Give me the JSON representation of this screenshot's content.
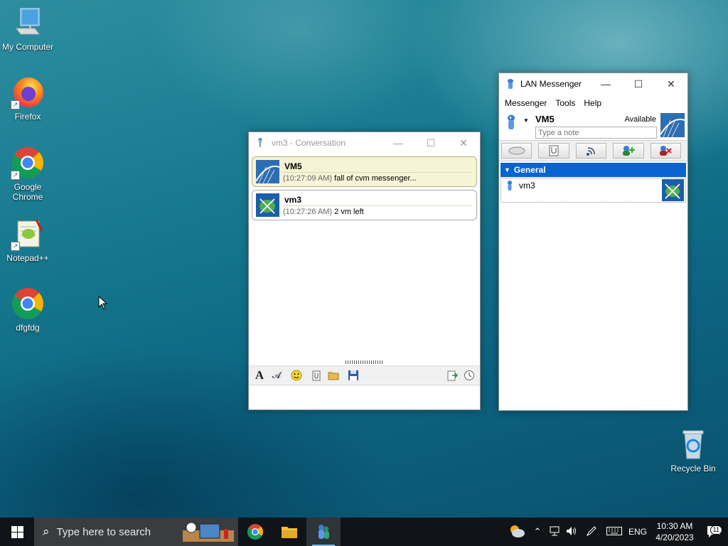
{
  "desktop": {
    "icons": [
      {
        "label": "My Computer"
      },
      {
        "label": "Firefox"
      },
      {
        "label": "Google Chrome"
      },
      {
        "label": "Notepad++"
      },
      {
        "label": "dfgfdg"
      },
      {
        "label": "Recycle Bin"
      }
    ]
  },
  "conversation": {
    "title": "vm3 - Conversation",
    "messages": [
      {
        "sender": "VM5",
        "time": "(10:27:09 AM)",
        "text": "fall of cvm messenger..."
      },
      {
        "sender": "vm3",
        "time": "(10:27:26 AM)",
        "text": "2 vm left"
      }
    ]
  },
  "messenger": {
    "title": "LAN Messenger",
    "menu": [
      "Messenger",
      "Tools",
      "Help"
    ],
    "user_name": "VM5",
    "status": "Available",
    "note_placeholder": "Type a note",
    "group": "General",
    "contacts": [
      {
        "name": "vm3"
      }
    ]
  },
  "taskbar": {
    "search_placeholder": "Type here to search",
    "language": "ENG",
    "time": "10:30 AM",
    "date": "4/20/2023",
    "notification_count": "11"
  },
  "colors": {
    "accent": "#0a64d0",
    "bubble_self": "#f5f4d6",
    "taskbar": "#101418"
  }
}
